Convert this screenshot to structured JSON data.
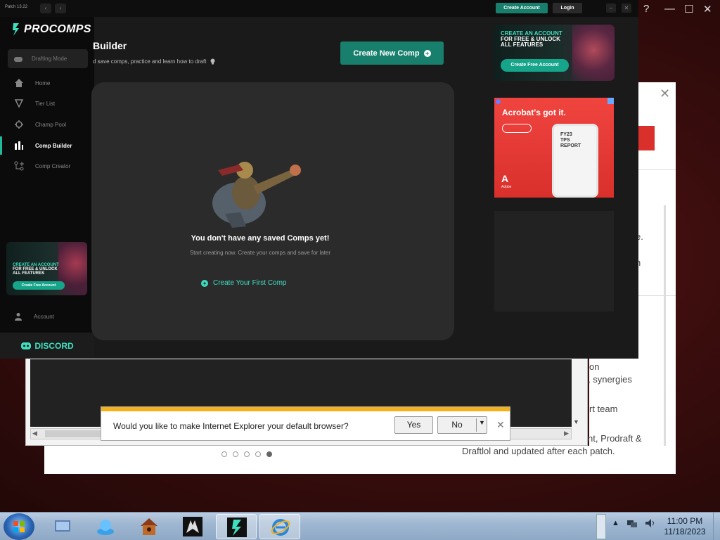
{
  "app": {
    "patch": "Patch 13.22",
    "create_account": "Create Account",
    "login": "Login",
    "logo_text": "PROCOMPS"
  },
  "sidebar": {
    "mode": "Drafting Mode",
    "items": [
      {
        "label": "Home",
        "icon": "home-icon"
      },
      {
        "label": "Tier List",
        "icon": "tier-list-icon"
      },
      {
        "label": "Champ Pool",
        "icon": "champ-pool-icon"
      },
      {
        "label": "Comp Builder",
        "icon": "comp-builder-icon",
        "active": true
      },
      {
        "label": "Comp Creator",
        "icon": "comp-creator-icon"
      }
    ],
    "promo": {
      "line1": "CREATE AN ACCOUNT",
      "line2": "FOR FREE & UNLOCK",
      "line3": "ALL FEATURES",
      "button": "Create Free Account"
    },
    "account": "Account",
    "discord": "DISCORD"
  },
  "main": {
    "title": "Builder",
    "subtitle": "d save comps, practice and learn how to draft",
    "new_comp_button": "Create New Comp",
    "empty_title": "You don't have any saved Comps yet!",
    "empty_subtitle": "Start creating now. Create your comps and save for later",
    "create_first": "Create Your First Comp"
  },
  "ads": {
    "account_promo": {
      "line1": "CREATE AN ACCOUNT",
      "line2": "FOR FREE & UNLOCK",
      "line3": "ALL FEATURES",
      "button": "Create Free Account"
    },
    "acrobat": {
      "headline": "Acrobat's got it.",
      "report": [
        "FY23",
        "TPS",
        "REPORT"
      ],
      "brand": "Adobe"
    }
  },
  "background_page": {
    "fragments": [
      "e.",
      "n",
      "on",
      ", synergies",
      "rt team",
      "nt, Prodraft &",
      "Draftlol and updated after each patch."
    ],
    "carousel_total": 5,
    "carousel_active": 5
  },
  "ie_prompt": {
    "question": "Would you like to make Internet Explorer your default browser?",
    "yes": "Yes",
    "no": "No"
  },
  "taskbar": {
    "time": "11:00 PM",
    "date": "11/18/2023",
    "apps": [
      "explorer-icon",
      "nova-icon",
      "birdhouse-icon",
      "wolf-icon",
      "procomps-icon",
      "internet-explorer-icon"
    ]
  },
  "colors": {
    "accent": "#177f6c",
    "teal_text": "#3ee0c0",
    "ad_red": "#d9302c",
    "prompt_bar": "#f3b21c"
  }
}
